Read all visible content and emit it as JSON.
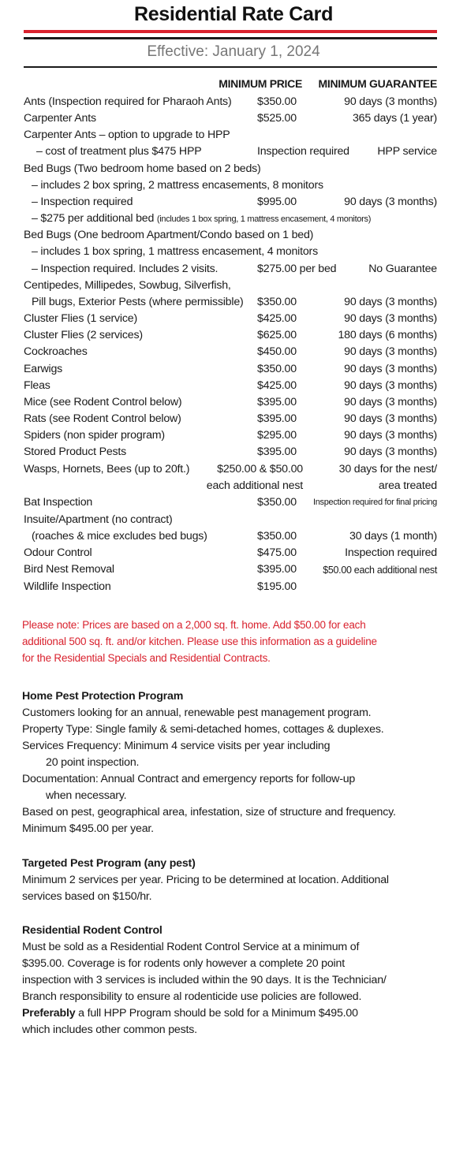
{
  "title": "Residential Rate Card",
  "effective": "Effective: January 1, 2024",
  "headers": {
    "price": "MINIMUM PRICE",
    "guarantee": "MINIMUM GUARANTEE"
  },
  "rows": [
    {
      "desc": "Ants (Inspection required for Pharaoh Ants)",
      "price": "$350.00",
      "guarantee": "90 days (3 months)"
    },
    {
      "desc": "Carpenter Ants",
      "price": "$525.00",
      "guarantee": "365 days (1 year)"
    },
    {
      "desc": "Carpenter Ants – option to upgrade to HPP",
      "price": "",
      "guarantee": ""
    },
    {
      "desc": "– cost of treatment plus $475 HPP",
      "price": "Inspection required",
      "guarantee": "HPP service"
    },
    {
      "desc": "Bed Bugs (Two bedroom home based on 2 beds)",
      "price": "",
      "guarantee": ""
    },
    {
      "desc": "– includes 2 box spring, 2 mattress encasements, 8 monitors",
      "price": "",
      "guarantee": ""
    },
    {
      "desc": "– Inspection required",
      "price": "$995.00",
      "guarantee": "90 days (3 months)"
    },
    {
      "desc": "– $275 per additional bed",
      "desc_small": "(includes 1 box spring, 1 mattress encasement, 4 monitors)",
      "price": "",
      "guarantee": ""
    },
    {
      "desc": "Bed Bugs (One bedroom Apartment/Condo based on 1 bed)",
      "price": "",
      "guarantee": ""
    },
    {
      "desc": "– includes 1 box spring, 1 mattress encasement, 4 monitors",
      "price": "",
      "guarantee": ""
    },
    {
      "desc": "– Inspection required. Includes 2 visits.",
      "price": "$275.00 per bed",
      "guarantee": "No Guarantee"
    },
    {
      "desc": "Centipedes, Millipedes, Sowbug, Silverfish,",
      "price": "",
      "guarantee": ""
    },
    {
      "desc": "Pill bugs, Exterior Pests (where permissible)",
      "price": "$350.00",
      "guarantee": "90 days (3 months)"
    },
    {
      "desc": "Cluster Flies (1 service)",
      "price": "$425.00",
      "guarantee": "90 days (3 months)"
    },
    {
      "desc": "Cluster Flies (2 services)",
      "price": "$625.00",
      "guarantee": "180 days (6 months)"
    },
    {
      "desc": "Cockroaches",
      "price": "$450.00",
      "guarantee": "90 days (3 months)"
    },
    {
      "desc": "Earwigs",
      "price": "$350.00",
      "guarantee": "90 days (3 months)"
    },
    {
      "desc": "Fleas",
      "price": "$425.00",
      "guarantee": "90 days (3 months)"
    },
    {
      "desc": "Mice (see Rodent Control below)",
      "price": "$395.00",
      "guarantee": "90 days (3 months)"
    },
    {
      "desc": "Rats (see Rodent Control below)",
      "price": "$395.00",
      "guarantee": "90 days (3 months)"
    },
    {
      "desc": "Spiders (non spider program)",
      "price": "$295.00",
      "guarantee": "90 days (3 months)"
    },
    {
      "desc": "Stored Product Pests",
      "price": "$395.00",
      "guarantee": "90 days (3 months)"
    },
    {
      "desc": "Wasps, Hornets, Bees (up to 20ft.)",
      "price": "$250.00 & $50.00",
      "guarantee": "30 days for the nest/"
    },
    {
      "desc": "",
      "price": "each additional nest",
      "guarantee": "area treated"
    },
    {
      "desc": "Bat Inspection",
      "price": "$350.00",
      "guarantee": "Inspection required for final pricing"
    },
    {
      "desc": "Insuite/Apartment (no contract)",
      "price": "",
      "guarantee": ""
    },
    {
      "desc": "(roaches & mice excludes bed bugs)",
      "price": "$350.00",
      "guarantee": "30 days (1 month)"
    },
    {
      "desc": "Odour Control",
      "price": "$475.00",
      "guarantee": "Inspection required"
    },
    {
      "desc": "Bird Nest Removal",
      "price": "$395.00",
      "guarantee": "$50.00 each additional nest"
    },
    {
      "desc": "Wildlife Inspection",
      "price": "$195.00",
      "guarantee": ""
    }
  ],
  "note": {
    "line1": "Please note: Prices are based on a 2,000 sq. ft. home. Add $50.00 for each",
    "line2": "additional 500 sq. ft. and/or kitchen. Please use this information as a guideline",
    "line3": "for the Residential Specials and Residential Contracts."
  },
  "hpp": {
    "heading": "Home Pest Protection Program",
    "l1": "Customers looking for an annual, renewable pest management program.",
    "l2": "Property Type: Single family & semi-detached homes, cottages & duplexes.",
    "l3": "Services Frequency: Minimum 4 service visits per year including",
    "l4": "20 point inspection.",
    "l5": "Documentation: Annual Contract and emergency reports for follow-up",
    "l6": "when necessary.",
    "l7": "Based on pest, geographical area, infestation, size of structure and frequency.",
    "l8": "Minimum $495.00 per year."
  },
  "targeted": {
    "heading": "Targeted Pest Program (any pest)",
    "l1": "Minimum 2 services per year. Pricing to be determined at location. Additional",
    "l2": "services based on $150/hr."
  },
  "rodent": {
    "heading": "Residential Rodent Control",
    "l1": "Must be sold as a Residential Rodent Control Service at a minimum of",
    "l2": "$395.00. Coverage is for rodents only however a complete 20 point",
    "l3": "inspection with 3 services is included within the 90 days. It is the Technician/",
    "l4": "Branch responsibility to ensure al rodenticide use policies are followed.",
    "l5_bold": "Preferably",
    "l5_rest": " a full HPP Program should be sold for a Minimum $495.00",
    "l6": "which includes other common pests."
  }
}
